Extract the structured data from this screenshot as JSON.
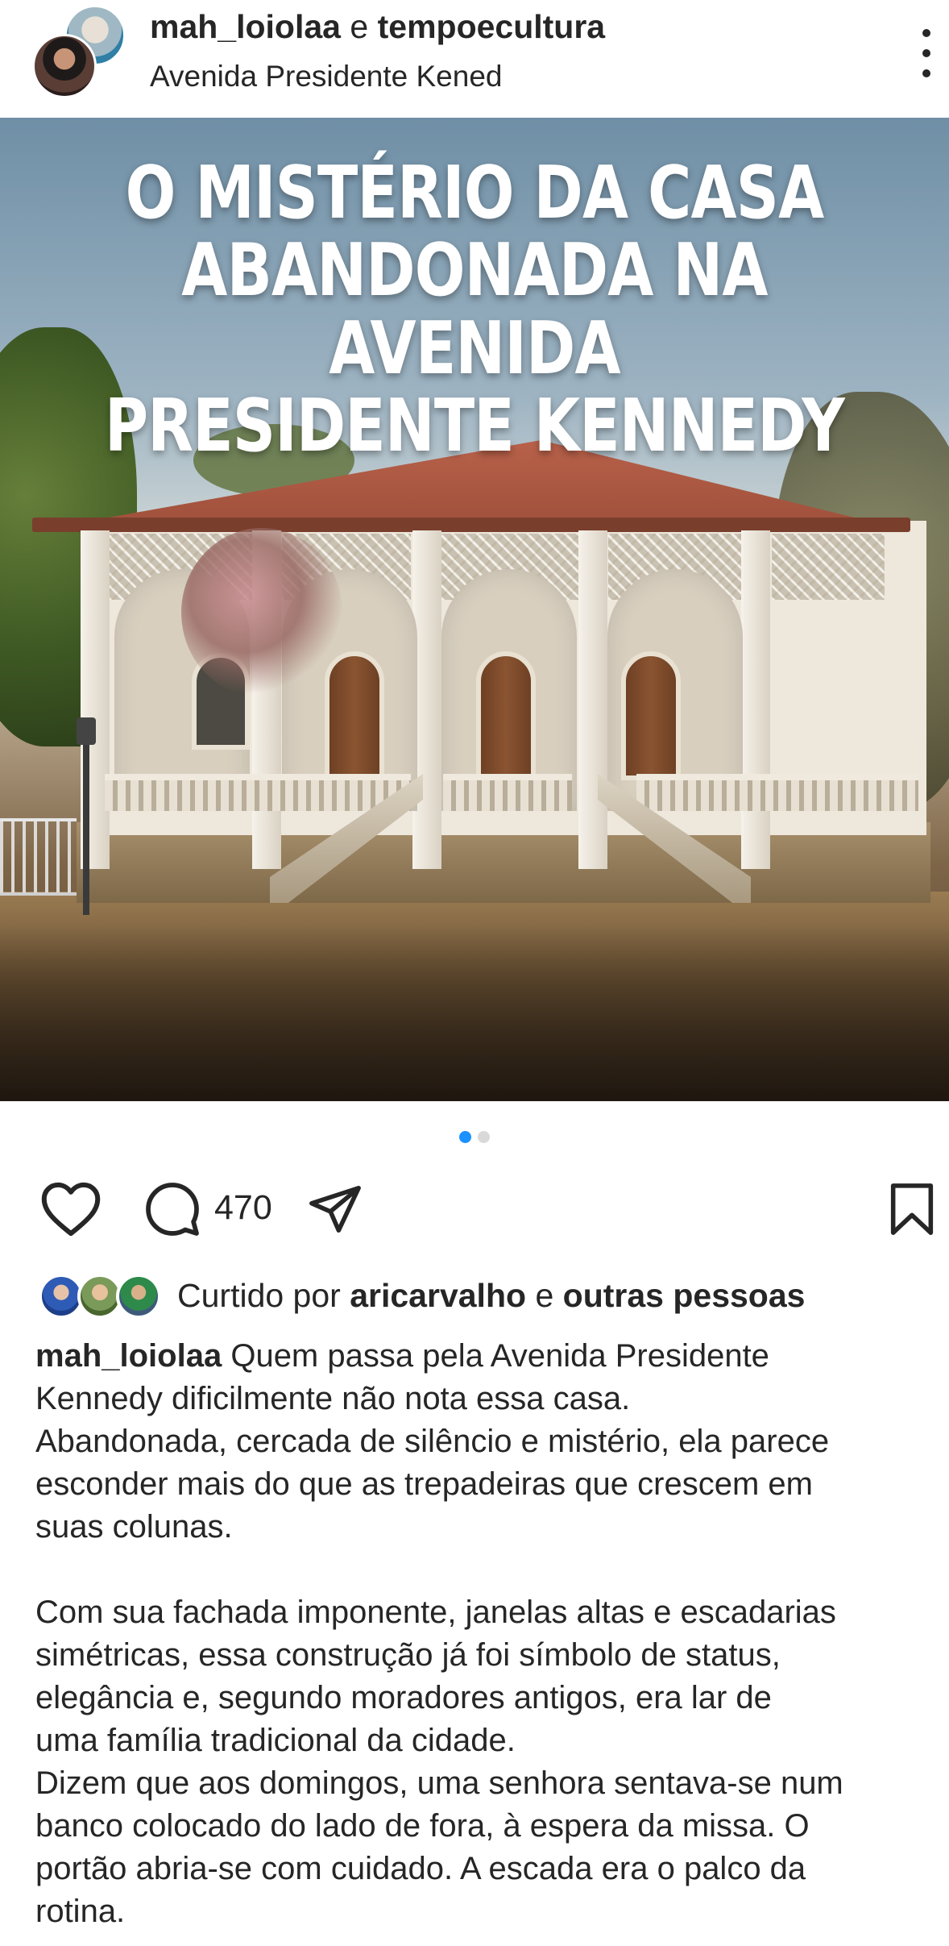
{
  "header": {
    "user1": "mah_loiolaa",
    "conjunction": "e",
    "user2": "tempoecultura",
    "location": "Avenida Presidente Kened",
    "more_icon": "more-vertical-icon"
  },
  "post": {
    "title_line1": "O MISTÉRIO DA CASA",
    "title_line2": "ABANDONADA NA AVENIDA",
    "title_line3": "PRESIDENTE KENNEDY",
    "carousel": {
      "total": 2,
      "active": 1
    }
  },
  "actions": {
    "like_icon": "heart-icon",
    "comment_icon": "comment-icon",
    "comment_count": "470",
    "share_icon": "send-icon",
    "save_icon": "bookmark-icon"
  },
  "likes": {
    "prefix": "Curtido por",
    "user": "aricarvalho",
    "conj": "e",
    "others": "outras pessoas"
  },
  "caption": {
    "user": "mah_loiolaa",
    "line1": "Quem passa pela Avenida Presidente",
    "line2": "Kennedy dificilmente não nota essa casa.",
    "line3": "Abandonada, cercada de silêncio e mistério, ela parece",
    "line4": "esconder mais do que as trepadeiras que crescem em",
    "line5": "suas colunas.",
    "line6": "Com sua fachada imponente, janelas altas e escadarias",
    "line7": "simétricas, essa construção já foi símbolo de status,",
    "line8": "elegância e, segundo moradores antigos, era lar de",
    "line9": "uma família tradicional da cidade.",
    "line10": "Dizem que aos domingos, uma senhora sentava-se num",
    "line11": "banco colocado do lado de fora, à espera da missa. O",
    "line12": "portão abria-se com cuidado. A escada era o palco da",
    "line13": "rotina."
  },
  "colors": {
    "text": "#262626",
    "accent_dot": "#1a91ff",
    "inactive_dot": "#d9d9d9",
    "background": "#ffffff"
  }
}
